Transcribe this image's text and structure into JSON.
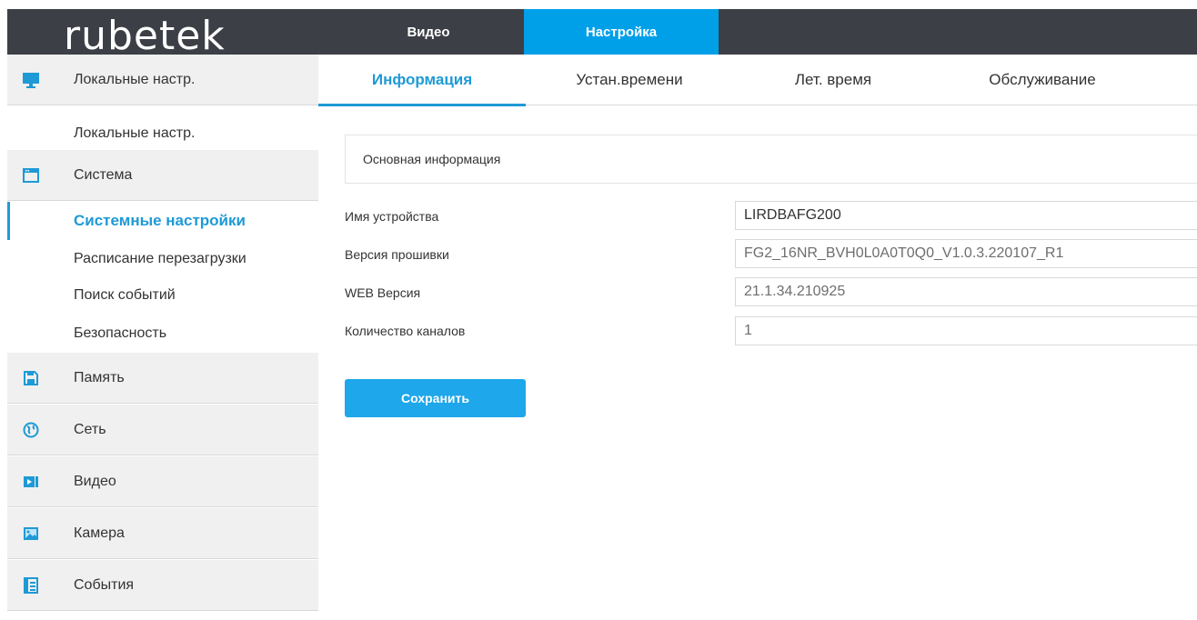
{
  "header": {
    "logo": "rubetek",
    "tabs": [
      {
        "label": "Видео"
      },
      {
        "label": "Настройка"
      }
    ]
  },
  "sidebar": {
    "items": [
      {
        "label": "Локальные настр.",
        "icon": "monitor-icon",
        "type": "main"
      },
      {
        "label": "Локальные настр.",
        "type": "sub"
      },
      {
        "label": "Система",
        "icon": "window-icon",
        "type": "main"
      },
      {
        "label": "Системные настройки",
        "type": "sub",
        "active": true
      },
      {
        "label": "Расписание перезагрузки",
        "type": "sub"
      },
      {
        "label": "Поиск событий",
        "type": "sub"
      },
      {
        "label": "Безопасность",
        "type": "sub"
      },
      {
        "label": "Память",
        "icon": "floppy-icon",
        "type": "main"
      },
      {
        "label": "Сеть",
        "icon": "globe-icon",
        "type": "main"
      },
      {
        "label": "Видео",
        "icon": "video-icon",
        "type": "main"
      },
      {
        "label": "Камера",
        "icon": "image-icon",
        "type": "main"
      },
      {
        "label": "События",
        "icon": "list-icon",
        "type": "main"
      }
    ]
  },
  "subtabs": [
    {
      "label": "Информация",
      "active": true
    },
    {
      "label": "Устан.времени"
    },
    {
      "label": "Лет. время"
    },
    {
      "label": "Обслуживание"
    }
  ],
  "section": {
    "title": "Основная информация"
  },
  "fields": [
    {
      "label": "Имя устройства",
      "value": "LIRDBAFG200"
    },
    {
      "label": "Версия прошивки",
      "value": "FG2_16NR_BVH0L0A0T0Q0_V1.0.3.220107_R1"
    },
    {
      "label": "WEB Версия",
      "value": "21.1.34.210925"
    },
    {
      "label": "Количество каналов",
      "value": "1"
    }
  ],
  "save_label": "Сохранить",
  "colors": {
    "accent": "#1e9ad6",
    "header_bg": "#3d3f47",
    "button": "#1ea7ea"
  }
}
